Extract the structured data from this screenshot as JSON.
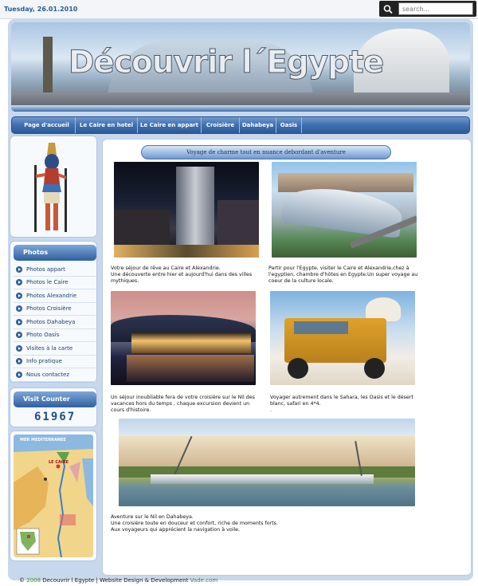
{
  "topbar": {
    "date": "Tuesday, 26.01.2010",
    "search": {
      "placeholder": "search..."
    }
  },
  "banner": {
    "title": "Découvrir l´Egypte"
  },
  "nav": {
    "items": [
      {
        "label": "Page d'accueil"
      },
      {
        "label": "Le Caire en hotel"
      },
      {
        "label": "Le Caire en appart"
      },
      {
        "label": "Croisière"
      },
      {
        "label": "Dahabeya"
      },
      {
        "label": "Oasis"
      }
    ]
  },
  "sidebar": {
    "photos_title": "Photos",
    "links": [
      {
        "label": "Photos appart"
      },
      {
        "label": "Photos le Caire"
      },
      {
        "label": "Photos Alexandrie"
      },
      {
        "label": "Photos Croisière"
      },
      {
        "label": "Photos Dahabeya"
      },
      {
        "label": "Photo Oasis"
      },
      {
        "label": "Visites à la carte"
      },
      {
        "label": "Info pratique"
      },
      {
        "label": "Nous contactez"
      }
    ],
    "counter_title": "Visit Counter",
    "counter_value": "61967",
    "map_label": "MER MEDITERRANEE",
    "map_city": "LE CAIRE"
  },
  "content": {
    "title": "Voyage de charme tout en nuance debordant d'aventure",
    "captions": [
      "Votre séjour de rêve au Caire et Alexandrie.\nUne découverte entre hier et aujourd'hui dans des villes mythiques.",
      "Partir pour l'Egypte, visiter le Caire et Alexandrie,chez à l'egyptien, chambre d'hôtes en Egypte.Un super voyage au coeur de la culture locale.",
      "Un séjour inoubliable fera de votre croisière sur le Nil des vacances hors du temps , chaque excursion devient un cours d'histoire.",
      "Voyager autrement dans le Sahara, les Oasis et le désert blanc, safari en 4*4.\n.",
      "Aventure sur le Nil en Dahabeya.\nUne croisière toute en douceur et confort, riche de moments forts.\nAux voyageurs qui apprécient la navigation à voile."
    ]
  },
  "footer": {
    "copyright": "©",
    "year": "2008",
    "text": " Decouvrir l Egypte | Website Design & Development ",
    "credit": "Vade.com"
  },
  "colors": {
    "accent": "#3f6fae",
    "nav_dark": "#2c5a99",
    "footer_link": "#3a8a2a"
  }
}
